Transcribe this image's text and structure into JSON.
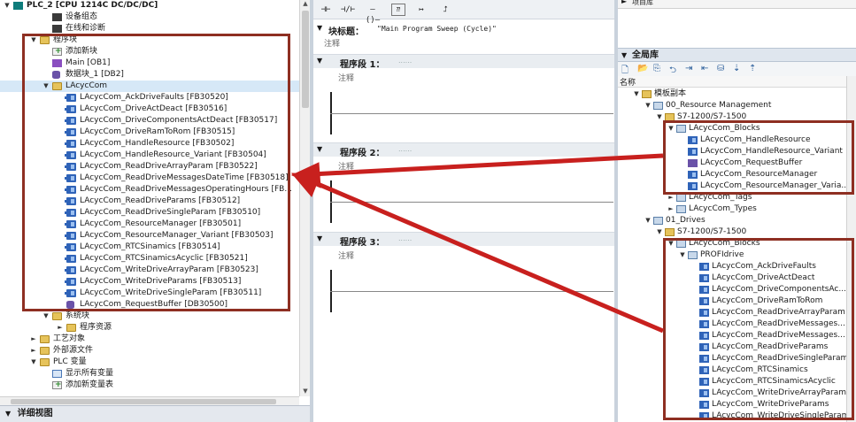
{
  "project_tree": {
    "items": [
      {
        "label": "PLC_2 [CPU 1214C DC/DC/DC]",
        "indent": 0,
        "icon": "cpu-icon",
        "expand": "▼",
        "bold": true
      },
      {
        "label": "设备组态",
        "indent": 3,
        "icon": "device-config-icon",
        "expand": ""
      },
      {
        "label": "在线和诊断",
        "indent": 3,
        "icon": "online-diagnostics-icon",
        "expand": ""
      },
      {
        "label": "程序块",
        "indent": 2,
        "icon": "folder-icon",
        "expand": "▼"
      },
      {
        "label": "添加新块",
        "indent": 3,
        "icon": "add-block-icon",
        "expand": ""
      },
      {
        "label": "Main [OB1]",
        "indent": 3,
        "icon": "ob-icon",
        "expand": ""
      },
      {
        "label": "数据块_1 [DB2]",
        "indent": 3,
        "icon": "db-icon",
        "expand": ""
      },
      {
        "label": "LAcycCom",
        "indent": 3,
        "icon": "folder-icon",
        "expand": "▼",
        "selected": true
      },
      {
        "label": "LAcycCom_AckDriveFaults [FB30520]",
        "indent": 4,
        "icon": "fb-icon"
      },
      {
        "label": "LAcycCom_DriveActDeact [FB30516]",
        "indent": 4,
        "icon": "fb-icon"
      },
      {
        "label": "LAcycCom_DriveComponentsActDeact [FB30517]",
        "indent": 4,
        "icon": "fb-icon"
      },
      {
        "label": "LAcycCom_DriveRamToRom [FB30515]",
        "indent": 4,
        "icon": "fb-icon"
      },
      {
        "label": "LAcycCom_HandleResource [FB30502]",
        "indent": 4,
        "icon": "fb-icon"
      },
      {
        "label": "LAcycCom_HandleResource_Variant [FB30504]",
        "indent": 4,
        "icon": "fb-icon"
      },
      {
        "label": "LAcycCom_ReadDriveArrayParam [FB30522]",
        "indent": 4,
        "icon": "fb-icon"
      },
      {
        "label": "LAcycCom_ReadDriveMessagesDateTime [FB30518]",
        "indent": 4,
        "icon": "fb-icon"
      },
      {
        "label": "LAcycCom_ReadDriveMessagesOperatingHours [FB...",
        "indent": 4,
        "icon": "fb-icon"
      },
      {
        "label": "LAcycCom_ReadDriveParams [FB30512]",
        "indent": 4,
        "icon": "fb-icon"
      },
      {
        "label": "LAcycCom_ReadDriveSingleParam [FB30510]",
        "indent": 4,
        "icon": "fb-icon"
      },
      {
        "label": "LAcycCom_ResourceManager [FB30501]",
        "indent": 4,
        "icon": "fb-icon"
      },
      {
        "label": "LAcycCom_ResourceManager_Variant [FB30503]",
        "indent": 4,
        "icon": "fb-icon"
      },
      {
        "label": "LAcycCom_RTCSinamics [FB30514]",
        "indent": 4,
        "icon": "fb-icon"
      },
      {
        "label": "LAcycCom_RTCSinamicsAcyclic [FB30521]",
        "indent": 4,
        "icon": "fb-icon"
      },
      {
        "label": "LAcycCom_WriteDriveArrayParam [FB30523]",
        "indent": 4,
        "icon": "fb-icon"
      },
      {
        "label": "LAcycCom_WriteDriveParams [FB30513]",
        "indent": 4,
        "icon": "fb-icon"
      },
      {
        "label": "LAcycCom_WriteDriveSingleParam [FB30511]",
        "indent": 4,
        "icon": "fb-icon"
      },
      {
        "label": "LAcycCom_RequestBuffer [DB30500]",
        "indent": 4,
        "icon": "db-icon"
      },
      {
        "label": "系统块",
        "indent": 3,
        "icon": "folder-icon",
        "expand": "▼"
      },
      {
        "label": "程序资源",
        "indent": 4,
        "icon": "folder-icon",
        "expand": "►"
      },
      {
        "label": "工艺对象",
        "indent": 2,
        "icon": "folder-icon",
        "expand": "►"
      },
      {
        "label": "外部源文件",
        "indent": 2,
        "icon": "folder-icon",
        "expand": "►"
      },
      {
        "label": "PLC 变量",
        "indent": 2,
        "icon": "folder-icon",
        "expand": "▼"
      },
      {
        "label": "显示所有变量",
        "indent": 3,
        "icon": "tags-icon",
        "expand": ""
      },
      {
        "label": "添加新变量表",
        "indent": 3,
        "icon": "add-tagtable-icon",
        "expand": ""
      }
    ]
  },
  "details_view": {
    "label": "详细视图",
    "arrow": "▼"
  },
  "editor": {
    "toolbar": [
      "⊣⊢",
      "⊣/⊢",
      "–()–",
      "⁇",
      "↦",
      "⮥"
    ],
    "block_title_label": "块标题：",
    "block_title_value": "\"Main Program Sweep (Cycle)\"",
    "block_comment": "注释",
    "networks": [
      {
        "label": "程序段 1：",
        "dots": "......",
        "comment": "注释"
      },
      {
        "label": "程序段 2：",
        "dots": "......",
        "comment": "注释"
      },
      {
        "label": "程序段 3：",
        "dots": "......",
        "comment": "注释"
      }
    ]
  },
  "library": {
    "project_lib_label": "项目库",
    "global_title": "全局库",
    "name_header": "名称",
    "items": [
      {
        "label": "模板副本",
        "indent": 1,
        "icon": "folder",
        "expand": "▼"
      },
      {
        "label": "00_Resource Management",
        "indent": 2,
        "icon": "lib",
        "expand": "▼"
      },
      {
        "label": "S7-1200/S7-1500",
        "indent": 3,
        "icon": "folder",
        "expand": "▼"
      },
      {
        "label": "LAcycCom_Blocks",
        "indent": 4,
        "icon": "lib",
        "expand": "▼"
      },
      {
        "label": "LAcycCom_HandleResource",
        "indent": 5,
        "icon": "fb"
      },
      {
        "label": "LAcycCom_HandleResource_Variant",
        "indent": 5,
        "icon": "fb"
      },
      {
        "label": "LAcycCom_RequestBuffer",
        "indent": 5,
        "icon": "db"
      },
      {
        "label": "LAcycCom_ResourceManager",
        "indent": 5,
        "icon": "fb"
      },
      {
        "label": "LAcycCom_ResourceManager_Varia...",
        "indent": 5,
        "icon": "fb"
      },
      {
        "label": "LAcycCom_Tags",
        "indent": 4,
        "icon": "lib",
        "expand": "►"
      },
      {
        "label": "LAcycCom_Types",
        "indent": 4,
        "icon": "lib",
        "expand": "►"
      },
      {
        "label": "01_Drives",
        "indent": 2,
        "icon": "lib",
        "expand": "▼"
      },
      {
        "label": "S7-1200/S7-1500",
        "indent": 3,
        "icon": "folder",
        "expand": "▼"
      },
      {
        "label": "LAcycCom_Blocks",
        "indent": 4,
        "icon": "lib",
        "expand": "▼"
      },
      {
        "label": "PROFIdrive",
        "indent": 5,
        "icon": "lib",
        "expand": "▼"
      },
      {
        "label": "LAcycCom_AckDriveFaults",
        "indent": 6,
        "icon": "fb"
      },
      {
        "label": "LAcycCom_DriveActDeact",
        "indent": 6,
        "icon": "fb"
      },
      {
        "label": "LAcycCom_DriveComponentsAc...",
        "indent": 6,
        "icon": "fb"
      },
      {
        "label": "LAcycCom_DriveRamToRom",
        "indent": 6,
        "icon": "fb"
      },
      {
        "label": "LAcycCom_ReadDriveArrayParam",
        "indent": 6,
        "icon": "fb"
      },
      {
        "label": "LAcycCom_ReadDriveMessages...",
        "indent": 6,
        "icon": "fb"
      },
      {
        "label": "LAcycCom_ReadDriveMessages...",
        "indent": 6,
        "icon": "fb"
      },
      {
        "label": "LAcycCom_ReadDriveParams",
        "indent": 6,
        "icon": "fb"
      },
      {
        "label": "LAcycCom_ReadDriveSingleParam",
        "indent": 6,
        "icon": "fb"
      },
      {
        "label": "LAcycCom_RTCSinamics",
        "indent": 6,
        "icon": "fb"
      },
      {
        "label": "LAcycCom_RTCSinamicsAcyclic",
        "indent": 6,
        "icon": "fb"
      },
      {
        "label": "LAcycCom_WriteDriveArrayParam",
        "indent": 6,
        "icon": "fb"
      },
      {
        "label": "LAcycCom_WriteDriveParams",
        "indent": 6,
        "icon": "fb"
      },
      {
        "label": "LAcycCom_WriteDriveSingleParam",
        "indent": 6,
        "icon": "fb"
      }
    ]
  },
  "colors": {
    "annotation_red": "#8e2f22",
    "arrow_red": "#c8201e",
    "selection": "#d6e8f7"
  }
}
